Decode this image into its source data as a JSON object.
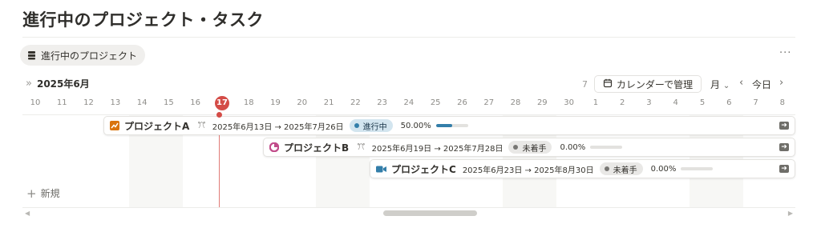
{
  "page": {
    "title": "進行中のプロジェクト・タスク"
  },
  "view": {
    "tab_label": "進行中のプロジェクト",
    "more_label": "···"
  },
  "timeline": {
    "month_label": "2025年6月",
    "collapse_glyph": "»",
    "week_count": "7",
    "calendar_button_label": "カレンダーで管理",
    "scale_label": "月",
    "scale_caret": "⌄",
    "today_label": "今日",
    "prev_glyph": "‹",
    "next_glyph": "›",
    "today_day": "17",
    "days": [
      "10",
      "11",
      "12",
      "13",
      "14",
      "15",
      "16",
      "17",
      "18",
      "19",
      "20",
      "21",
      "22",
      "23",
      "24",
      "25",
      "26",
      "27",
      "28",
      "29",
      "30",
      "1",
      "2",
      "3",
      "4",
      "5",
      "6",
      "7",
      "8"
    ]
  },
  "projects": [
    {
      "name": "プロジェクトA",
      "icon": "chart-up-icon",
      "icon_color": "#d9730d",
      "people_glyph": "ꔫ",
      "dates": "2025年6月13日 → 2025年7月26日",
      "status": "進行中",
      "status_bg": "#d3e5ef",
      "status_dot": "#337ea9",
      "progress_text": "50.00%",
      "progress": 0.5,
      "progress_color": "#337ea9"
    },
    {
      "name": "プロジェクトB",
      "icon": "pie-chart-icon",
      "icon_color": "#c14c8a",
      "people_glyph": "ꔫ",
      "dates": "2025年6月19日 → 2025年7月28日",
      "status": "未着手",
      "status_bg": "#e9e8e6",
      "status_dot": "#787774",
      "progress_text": "0.00%",
      "progress": 0
    },
    {
      "name": "プロジェクトC",
      "icon": "video-camera-icon",
      "icon_color": "#337ea9",
      "dates": "2025年6月23日 → 2025年8月30日",
      "status": "未着手",
      "status_bg": "#e9e8e6",
      "status_dot": "#787774",
      "progress_text": "0.00%",
      "progress": 0
    }
  ],
  "new_row": {
    "label": "新規",
    "plus": "+"
  },
  "colors": {
    "today_marker": "#d44c47",
    "weekend_shade": "#f7f7f5"
  }
}
